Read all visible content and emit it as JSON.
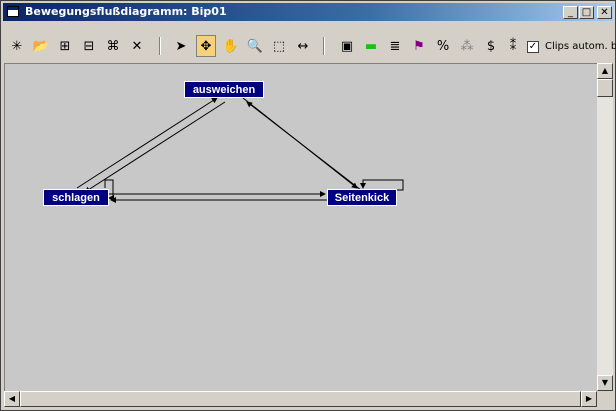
{
  "window": {
    "title": "Bewegungsflußdiagramm: Bip01",
    "controls": {
      "minimize": "_",
      "maximize": "□",
      "close": "✕"
    }
  },
  "toolbar": {
    "tools": [
      {
        "name": "new-icon",
        "glyph": "✳"
      },
      {
        "name": "open-icon",
        "glyph": "📂"
      },
      {
        "name": "insert-icon",
        "glyph": "⊞"
      },
      {
        "name": "insert-below-icon",
        "glyph": "⊟"
      },
      {
        "name": "cluster-icon",
        "glyph": "⌘"
      },
      {
        "name": "delete-icon",
        "glyph": "✕"
      },
      {
        "name": "select-arrow-icon",
        "glyph": "➤"
      },
      {
        "name": "move-icon",
        "glyph": "✥"
      },
      {
        "name": "pan-hand-icon",
        "glyph": "✋"
      },
      {
        "name": "zoom-icon",
        "glyph": "🔍"
      },
      {
        "name": "zoom-region-icon",
        "glyph": "⬚"
      },
      {
        "name": "fit-width-icon",
        "glyph": "↔"
      },
      {
        "name": "script-icon",
        "glyph": "▣"
      },
      {
        "name": "green-bar-icon",
        "glyph": "▬"
      },
      {
        "name": "list-icon",
        "glyph": "≣"
      },
      {
        "name": "flag-select-icon",
        "glyph": "⚑"
      },
      {
        "name": "percent-icon",
        "glyph": "%"
      },
      {
        "name": "random-icon",
        "glyph": "⁂"
      },
      {
        "name": "dollar-icon",
        "glyph": "$"
      },
      {
        "name": "info-icon",
        "glyph": "⁑"
      }
    ],
    "checkbox_checked": "✓",
    "checkbox_label": "Clips autom. be"
  },
  "diagram": {
    "nodes": {
      "ausweichen": "ausweichen",
      "schlagen": "schlagen",
      "seitenkick": "Seitenkick"
    }
  },
  "scrollbar": {
    "up": "▲",
    "down": "▼",
    "left": "◀",
    "right": "▶"
  }
}
